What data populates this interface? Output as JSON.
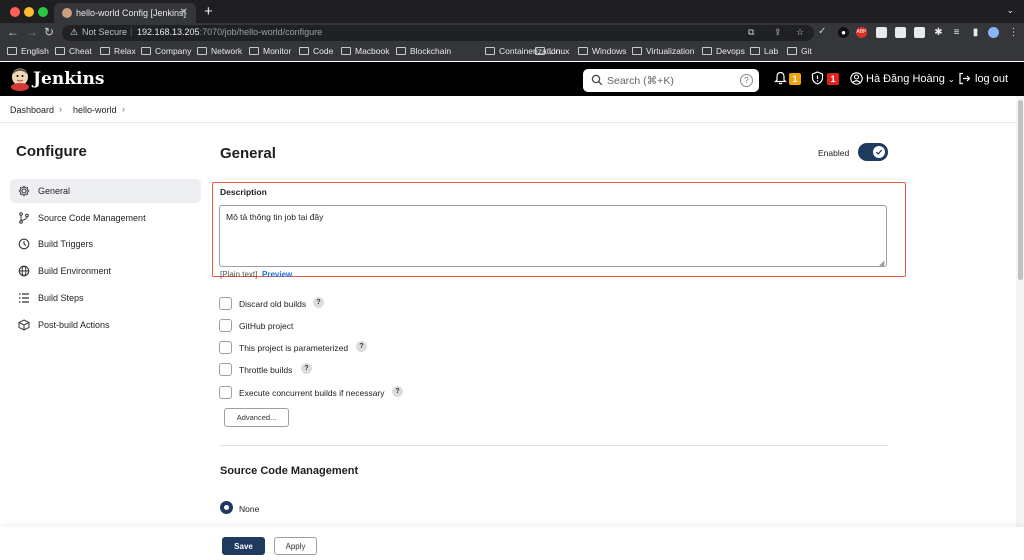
{
  "browser": {
    "tab_title": "hello-world Config [Jenkins]",
    "new_tab": "+",
    "security_label": "Not Secure",
    "url_host": "192.168.13.205",
    "url_path": ":7070/job/hello-world/configure",
    "bookmarks": [
      "English",
      "Cheat",
      "Relax",
      "Company",
      "Network",
      "Monitor",
      "Code",
      "Macbook",
      "Blockchain",
      "Containerization",
      "Linux",
      "Windows",
      "Virtualization",
      "Devops",
      "Lab",
      "Git"
    ]
  },
  "header": {
    "brand": "Jenkins",
    "search_placeholder": "Search (⌘+K)",
    "search_help": "?",
    "notifications_count": "1",
    "security_count": "1",
    "user_name": "Hà Đăng Hoàng",
    "logout_label": "log out"
  },
  "breadcrumb": [
    "Dashboard",
    "hello-world"
  ],
  "sidebar": {
    "title": "Configure",
    "items": [
      {
        "label": "General",
        "icon": "gear-icon"
      },
      {
        "label": "Source Code Management",
        "icon": "branch-icon"
      },
      {
        "label": "Build Triggers",
        "icon": "clock-icon"
      },
      {
        "label": "Build Environment",
        "icon": "globe-icon"
      },
      {
        "label": "Build Steps",
        "icon": "list-icon"
      },
      {
        "label": "Post-build Actions",
        "icon": "cube-icon"
      }
    ]
  },
  "general": {
    "title": "General",
    "enabled_label": "Enabled",
    "description_label": "Description",
    "description_value": "Mô tả thông tin job tại đây",
    "plain_text": "[Plain text]",
    "preview_label": "Preview",
    "options": [
      {
        "label": "Discard old builds",
        "help": "?"
      },
      {
        "label": "GitHub project",
        "help": ""
      },
      {
        "label": "This project is parameterized",
        "help": "?"
      },
      {
        "label": "Throttle builds",
        "help": "?"
      },
      {
        "label": "Execute concurrent builds if necessary",
        "help": "?"
      }
    ],
    "advanced_label": "Advanced..."
  },
  "scm": {
    "title": "Source Code Management",
    "selected_option": "None"
  },
  "footer": {
    "save_label": "Save",
    "apply_label": "Apply"
  },
  "colors": {
    "accent": "#1e3a5f",
    "highlight_border": "#e55b3c",
    "notification_badge": "#f0a30a",
    "security_badge": "#e2211c"
  }
}
